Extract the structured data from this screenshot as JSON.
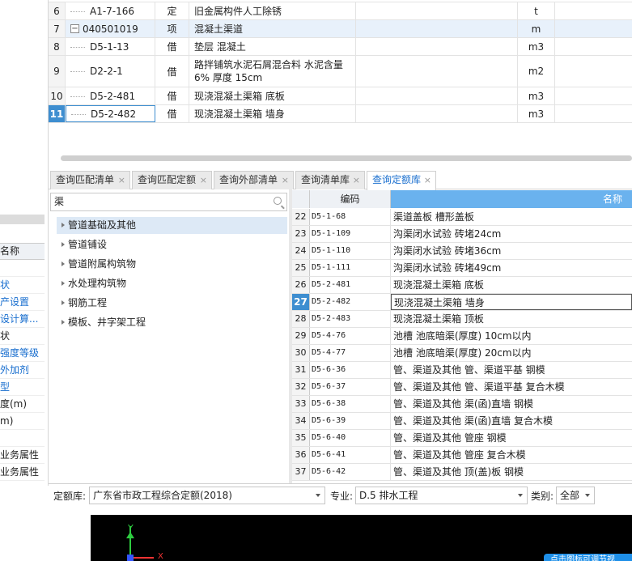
{
  "left_panel": {
    "header": "名称",
    "header_prefix": "名称",
    "rows": [
      {
        "text": "",
        "link": false
      },
      {
        "text": "状",
        "link": true
      },
      {
        "text": "产设置",
        "link": true
      },
      {
        "text": "设计算...",
        "link": true
      },
      {
        "text": "状",
        "link": false
      },
      {
        "text": "强度等级",
        "link": true
      },
      {
        "text": "外加剂",
        "link": true
      },
      {
        "text": "型",
        "link": true
      },
      {
        "text": "度(m)",
        "link": false
      },
      {
        "text": "m)",
        "link": false
      },
      {
        "text": "",
        "link": false
      },
      {
        "text": "业务属性",
        "link": false
      },
      {
        "text": "业务属性",
        "link": false
      }
    ]
  },
  "top_table": {
    "rows": [
      {
        "num": "6",
        "code": "A1-7-166",
        "type": "定",
        "name": "旧金属构件人工除锈",
        "unit": "t",
        "indent": true
      },
      {
        "num": "7",
        "code": "040501019",
        "type": "项",
        "name": "混凝土渠道",
        "unit": "m",
        "collapse": "−",
        "selected": true
      },
      {
        "num": "8",
        "code": "D5-1-13",
        "type": "借",
        "name": "垫层 混凝土",
        "unit": "m3",
        "indent": true
      },
      {
        "num": "9",
        "code": "D2-2-1",
        "type": "借",
        "name": "路拌铺筑水泥石屑混合料 水泥含量6% 厚度 15cm",
        "unit": "m2",
        "indent": true
      },
      {
        "num": "10",
        "code": "D5-2-481",
        "type": "借",
        "name": "现浇混凝土渠箱 底板",
        "unit": "m3",
        "indent": true
      },
      {
        "num": "11",
        "code": "D5-2-482",
        "type": "借",
        "name": "现浇混凝土渠箱 墙身",
        "unit": "m3",
        "indent": true,
        "active": true
      }
    ]
  },
  "tabs": [
    {
      "label": "查询匹配清单",
      "close": "×",
      "active": false
    },
    {
      "label": "查询匹配定额",
      "close": "×",
      "active": false
    },
    {
      "label": "查询外部清单",
      "close": "×",
      "active": false
    },
    {
      "label": "查询清单库",
      "close": "×",
      "active": false
    },
    {
      "label": "查询定额库",
      "close": "×",
      "active": true
    }
  ],
  "search": {
    "value": "渠",
    "icon": "search-icon"
  },
  "tree": [
    {
      "label": "管道基础及其他",
      "selected": true
    },
    {
      "label": "管道铺设",
      "selected": false
    },
    {
      "label": "管道附属构筑物",
      "selected": false
    },
    {
      "label": "水处理构筑物",
      "selected": false
    },
    {
      "label": "钢筋工程",
      "selected": false
    },
    {
      "label": "模板、井字架工程",
      "selected": false
    }
  ],
  "quota_table": {
    "headers": {
      "code": "编码",
      "name": "名称"
    },
    "rows": [
      {
        "num": "22",
        "code": "D5-1-68",
        "name": "渠道盖板 槽形盖板"
      },
      {
        "num": "23",
        "code": "D5-1-109",
        "name": "沟渠闭水试验 砖堵24cm"
      },
      {
        "num": "24",
        "code": "D5-1-110",
        "name": "沟渠闭水试验 砖堵36cm"
      },
      {
        "num": "25",
        "code": "D5-1-111",
        "name": "沟渠闭水试验 砖堵49cm"
      },
      {
        "num": "26",
        "code": "D5-2-481",
        "name": "现浇混凝土渠箱 底板"
      },
      {
        "num": "27",
        "code": "D5-2-482",
        "name": "现浇混凝土渠箱 墙身",
        "active": true
      },
      {
        "num": "28",
        "code": "D5-2-483",
        "name": "现浇混凝土渠箱 顶板"
      },
      {
        "num": "29",
        "code": "D5-4-76",
        "name": "池槽 池底暗渠(厚度) 10cm以内"
      },
      {
        "num": "30",
        "code": "D5-4-77",
        "name": "池槽 池底暗渠(厚度) 20cm以内"
      },
      {
        "num": "31",
        "code": "D5-6-36",
        "name": "管、渠道及其他 管、渠道平基 钢模"
      },
      {
        "num": "32",
        "code": "D5-6-37",
        "name": "管、渠道及其他 管、渠道平基 复合木模"
      },
      {
        "num": "33",
        "code": "D5-6-38",
        "name": "管、渠道及其他 渠(函)直墙 钢模"
      },
      {
        "num": "34",
        "code": "D5-6-39",
        "name": "管、渠道及其他 渠(函)直墙 复合木模"
      },
      {
        "num": "35",
        "code": "D5-6-40",
        "name": "管、渠道及其他 管座 钢模"
      },
      {
        "num": "36",
        "code": "D5-6-41",
        "name": "管、渠道及其他 管座 复合木模"
      },
      {
        "num": "37",
        "code": "D5-6-42",
        "name": "管、渠道及其他 顶(盖)板 钢模"
      }
    ]
  },
  "filters": {
    "quota_lib_label": "定额库:",
    "quota_lib_value": "广东省市政工程综合定额(2018)",
    "major_label": "专业:",
    "major_value": "D.5 排水工程",
    "category_label": "类别:",
    "category_value": "全部"
  },
  "viewport": {
    "axis_y_label": "Y",
    "axis_x_label": "X",
    "button_text": "点击图标可调节视"
  }
}
